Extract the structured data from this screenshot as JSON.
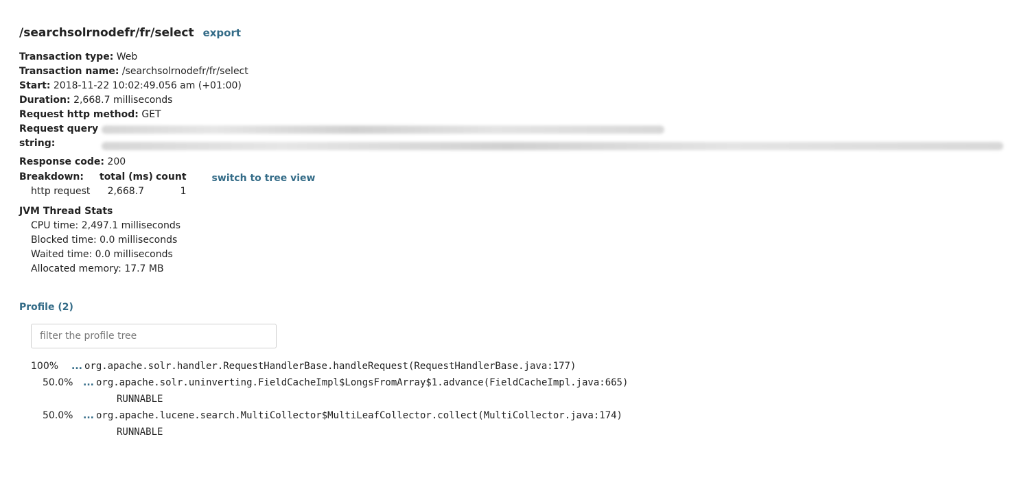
{
  "header": {
    "title": "/searchsolrnodefr/fr/select",
    "export_label": "export"
  },
  "info": {
    "type_label": "Transaction type:",
    "type_value": "Web",
    "name_label": "Transaction name:",
    "name_value": "/searchsolrnodefr/fr/select",
    "start_label": "Start:",
    "start_value": "2018-11-22 10:02:49.056 am (+01:00)",
    "duration_label": "Duration:",
    "duration_value": "2,668.7 milliseconds",
    "method_label": "Request http method:",
    "method_value": "GET",
    "query_label_1": "Request query",
    "query_label_2": "string:",
    "response_label": "Response code:",
    "response_value": "200"
  },
  "breakdown": {
    "label": "Breakdown:",
    "col_total": "total (ms)",
    "col_count": "count",
    "rows": [
      {
        "name": "http request",
        "total": "2,668.7",
        "count": "1"
      }
    ],
    "switch_label": "switch to tree view"
  },
  "jvm": {
    "title": "JVM Thread Stats",
    "cpu": "CPU time: 2,497.1 milliseconds",
    "blocked": "Blocked time: 0.0 milliseconds",
    "waited": "Waited time: 0.0 milliseconds",
    "memory": "Allocated memory: 17.7 MB"
  },
  "profile": {
    "link_label": "Profile (2)",
    "filter_placeholder": "filter the profile tree",
    "dots": "...",
    "nodes": [
      {
        "pct": "100%",
        "frame": "org.apache.solr.handler.RequestHandlerBase.handleRequest(RequestHandlerBase.java:177)"
      },
      {
        "pct": "50.0%",
        "frame": "org.apache.solr.uninverting.FieldCacheImpl$LongsFromArray$1.advance(FieldCacheImpl.java:665)",
        "state": "RUNNABLE"
      },
      {
        "pct": "50.0%",
        "frame": "org.apache.lucene.search.MultiCollector$MultiLeafCollector.collect(MultiCollector.java:174)",
        "state": "RUNNABLE"
      }
    ]
  }
}
